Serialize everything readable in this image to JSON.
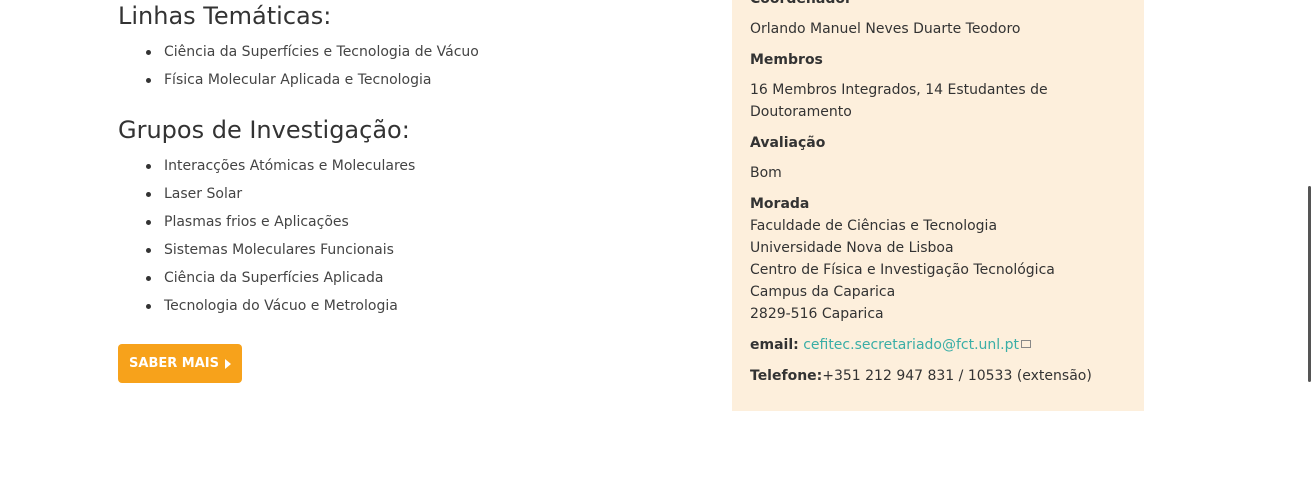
{
  "linhas": {
    "title": "Linhas Temáticas:",
    "items": [
      "Ciência da Superfícies e Tecnologia de Vácuo",
      "Física Molecular Aplicada e Tecnologia"
    ]
  },
  "grupos": {
    "title": "Grupos de Investigação:",
    "items": [
      "Interacções Atómicas e Moleculares",
      "Laser Solar",
      "Plasmas frios e Aplicações",
      "Sistemas Moleculares Funcionais",
      "Ciência da Superfícies Aplicada",
      "Tecnologia do Vácuo e Metrologia"
    ]
  },
  "button": {
    "label": "SABER MAIS"
  },
  "panel": {
    "coordenador_label": "Coordenador",
    "coordenador": "Orlando Manuel Neves Duarte Teodoro",
    "membros_label": "Membros",
    "membros": "16 Membros Integrados, 14 Estudantes de Doutoramento",
    "avaliacao_label": "Avaliação",
    "avaliacao": "Bom",
    "morada_label": "Morada",
    "morada_lines": [
      "Faculdade de Ciências e Tecnologia",
      "Universidade Nova de Lisboa",
      "Centro de Física e Investigação Tecnológica",
      "Campus da Caparica",
      "2829-516 Caparica"
    ],
    "email_label": "email:",
    "email": "cefitec.secretariado@fct.unl.pt",
    "telefone_label": "Telefone:",
    "telefone": "+351 212 947 831 / 10533 (extensão)"
  },
  "colors": {
    "accent": "#f7a21b",
    "panel_bg": "#fdefdc",
    "link": "#3aaea6"
  }
}
